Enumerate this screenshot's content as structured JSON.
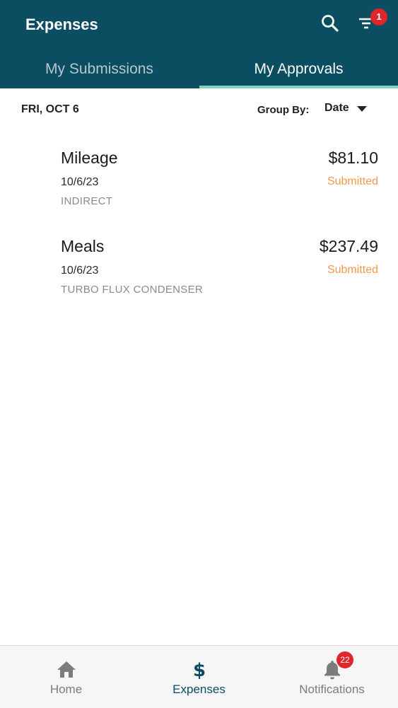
{
  "header": {
    "title": "Expenses",
    "filter_badge": "1"
  },
  "tabs": [
    {
      "label": "My Submissions",
      "active": false
    },
    {
      "label": "My Approvals",
      "active": true
    }
  ],
  "group": {
    "date_heading": "FRI, OCT 6",
    "group_by_label": "Group By:",
    "group_by_value": "Date"
  },
  "expenses": [
    {
      "name": "Mileage",
      "amount": "$81.10",
      "date": "10/6/23",
      "status": "Submitted",
      "project": "INDIRECT"
    },
    {
      "name": "Meals",
      "amount": "$237.49",
      "date": "10/6/23",
      "status": "Submitted",
      "project": "TURBO FLUX CONDENSER"
    }
  ],
  "bottom_nav": [
    {
      "label": "Home",
      "icon": "home-icon"
    },
    {
      "label": "Expenses",
      "icon": "dollar-icon",
      "active": true
    },
    {
      "label": "Notifications",
      "icon": "bell-icon",
      "badge": "22"
    }
  ],
  "colors": {
    "header_bg": "#0b4d61",
    "tab_indicator": "#84d1b8",
    "status_submitted": "#f3994a",
    "badge": "#e0262a",
    "nav_active": "#0b4d61"
  }
}
